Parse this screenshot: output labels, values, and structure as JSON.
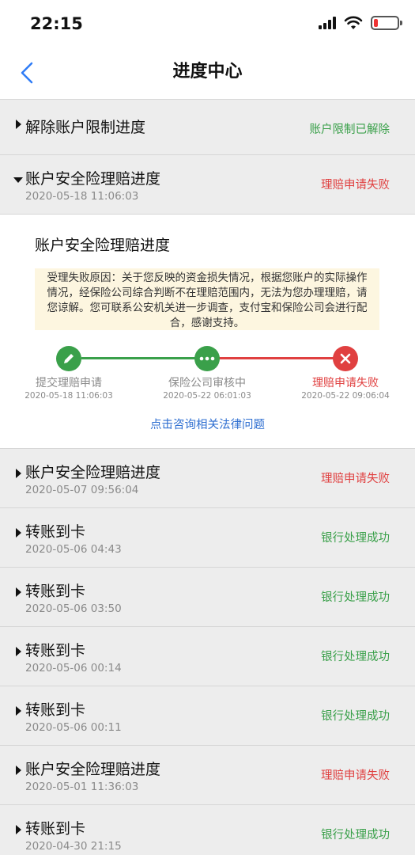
{
  "status_bar": {
    "time": "22:15"
  },
  "nav": {
    "title": "进度中心"
  },
  "first_row": {
    "title": "解除账户限制进度",
    "status": "账户限制已解除"
  },
  "expanded_row": {
    "title": "账户安全险理赔进度",
    "date": "2020-05-18 11:06:03",
    "status": "理赔申请失败"
  },
  "detail": {
    "title": "账户安全险理赔进度",
    "notice": "受理失败原因：关于您反映的资金损失情况，根据您账户的实际操作情况，经保险公司综合判断不在理赔范围内，无法为您办理理赔，请您谅解。您可联系公安机关进一步调查，支付宝和保险公司会进行配合，感谢支持。",
    "steps": [
      {
        "label": "提交理赔申请",
        "date": "2020-05-18 11:06:03"
      },
      {
        "label": "保险公司审核中",
        "date": "2020-05-22 06:01:03"
      },
      {
        "label": "理赔申请失败",
        "date": "2020-05-22 09:06:04"
      }
    ],
    "consult_link": "点击咨询相关法律问题"
  },
  "rows": [
    {
      "title": "账户安全险理赔进度",
      "date": "2020-05-07 09:56:04",
      "status": "理赔申请失败"
    },
    {
      "title": "转账到卡",
      "date": "2020-05-06 04:43",
      "status": "银行处理成功"
    },
    {
      "title": "转账到卡",
      "date": "2020-05-06 03:50",
      "status": "银行处理成功"
    },
    {
      "title": "转账到卡",
      "date": "2020-05-06 00:14",
      "status": "银行处理成功"
    },
    {
      "title": "转账到卡",
      "date": "2020-05-06 00:11",
      "status": "银行处理成功"
    },
    {
      "title": "账户安全险理赔进度",
      "date": "2020-05-01 11:36:03",
      "status": "理赔申请失败"
    },
    {
      "title": "转账到卡",
      "date": "2020-04-30 21:15",
      "status": "银行处理成功"
    }
  ],
  "colors": {
    "success": "#3aa04a",
    "failure": "#e04040",
    "link": "#2f6fd1",
    "notice_bg": "#fdf6e0"
  }
}
